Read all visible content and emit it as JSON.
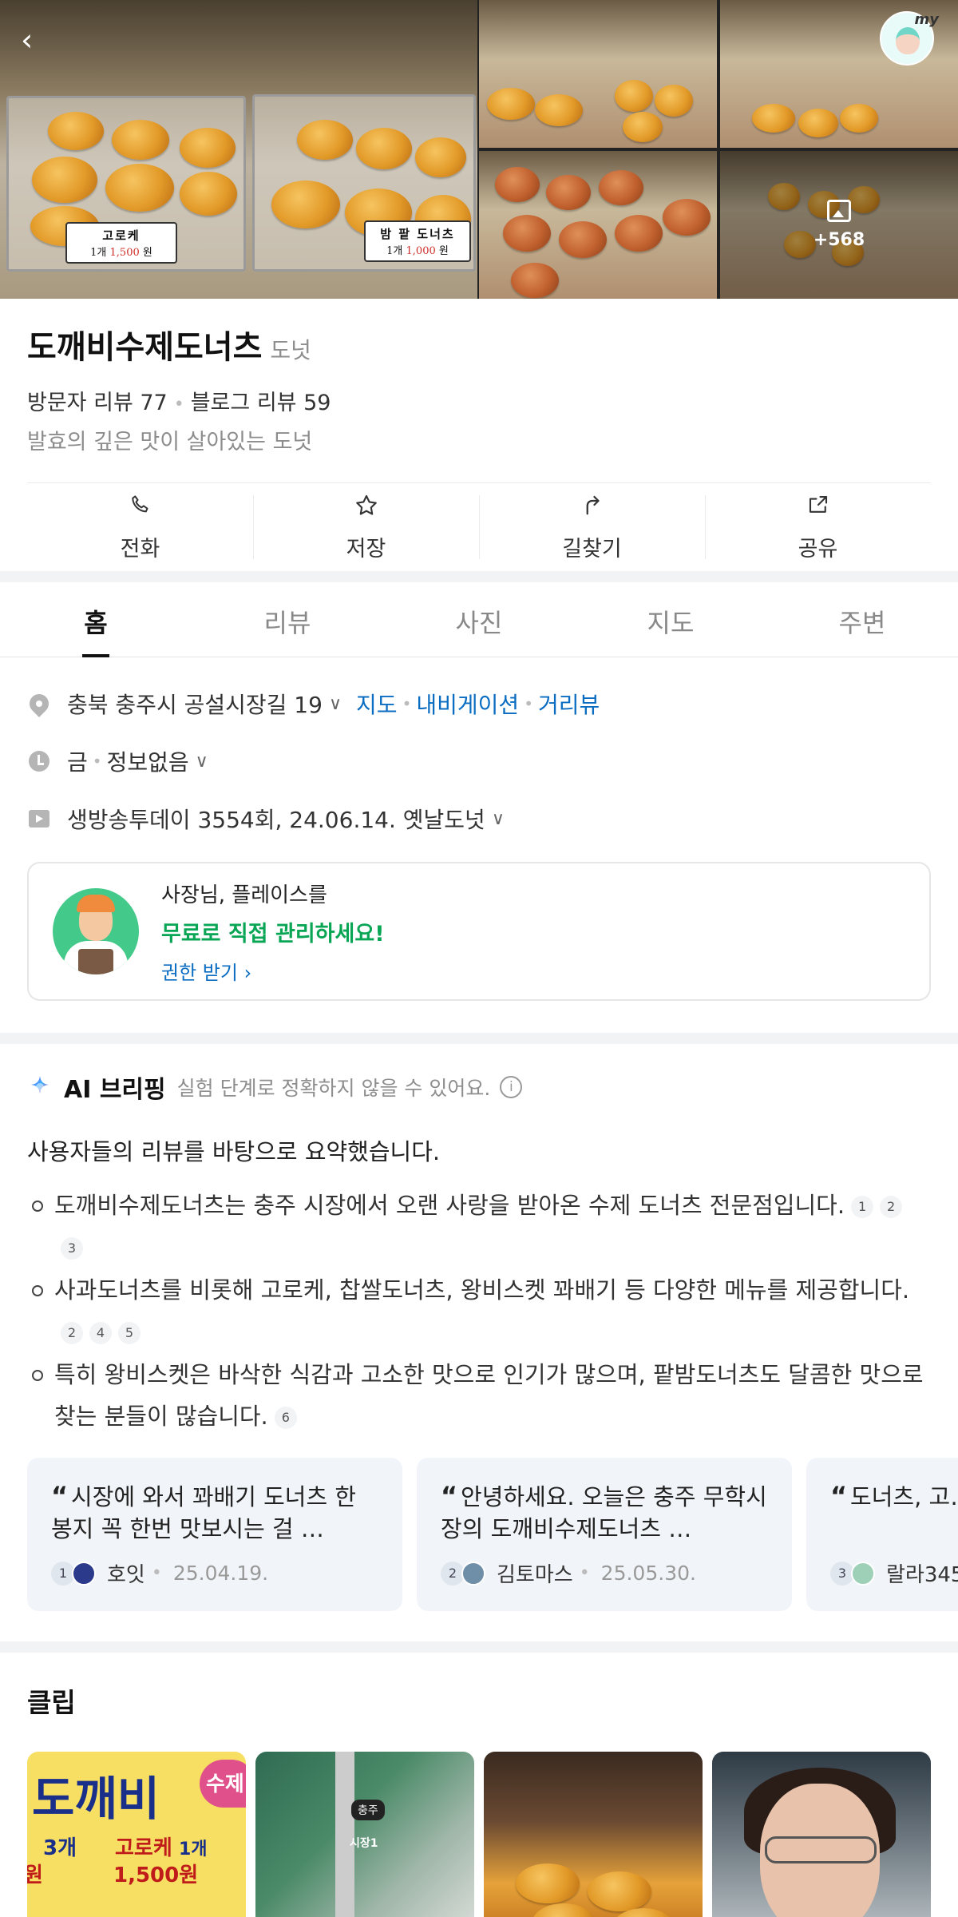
{
  "gallery": {
    "main_photo": {
      "label_left": {
        "name": "고로케",
        "qty": "1개",
        "price": "1,500",
        "unit": "원"
      },
      "label_right": {
        "name": "밤 팥 도너츠",
        "qty": "1개",
        "price": "1,000",
        "unit": "원"
      }
    },
    "more_count": "+568",
    "icons": {
      "back": "back-arrow-icon",
      "avatar": "my-avatar-icon",
      "photo": "photo-icon"
    },
    "avatar_label": "my"
  },
  "place": {
    "name": "도깨비수제도너츠",
    "category": "도넛",
    "visitor_reviews": "방문자 리뷰 77",
    "blog_reviews": "블로그 리뷰 59",
    "tagline": "발효의 깊은 맛이 살아있는 도넛"
  },
  "actions": [
    {
      "label": "전화",
      "icon": "phone-icon"
    },
    {
      "label": "저장",
      "icon": "star-icon"
    },
    {
      "label": "길찾기",
      "icon": "directions-icon"
    },
    {
      "label": "공유",
      "icon": "share-icon"
    }
  ],
  "tabs": [
    "홈",
    "리뷰",
    "사진",
    "지도",
    "주변"
  ],
  "info": {
    "address": "충북 충주시 공설시장길 19",
    "map_link": "지도",
    "nav_link": "내비게이션",
    "street_link": "거리뷰",
    "hours_day": "금",
    "hours_status": "정보없음",
    "tv": "생방송투데이 3554회, 24.06.14. 옛날도넛"
  },
  "owner_card": {
    "line1": "사장님, 플레이스를",
    "line2": "무료로 직접 관리하세요!",
    "line3": "권한 받기"
  },
  "ai": {
    "title": "AI 브리핑",
    "subtitle": "실험 단계로 정확하지 않을 수 있어요.",
    "intro": "사용자들의 리뷰를 바탕으로 요약했습니다.",
    "items": [
      {
        "text": "도깨비수제도너츠는 충주 시장에서 오랜 사랑을 받아온 수제 도너츠 전문점입니다.",
        "refs": [
          "1",
          "2",
          "3"
        ]
      },
      {
        "text": "사과도너츠를 비롯해 고로케, 찹쌀도너츠, 왕비스켓 꽈배기 등 다양한 메뉴를 제공합니다.",
        "refs": [
          "2",
          "4",
          "5"
        ]
      },
      {
        "text": "특히 왕비스켓은 바삭한 식감과 고소한 맛으로 인기가 많으며, 팥밤도너츠도 달콤한 맛으로 찾는 분들이 많습니다.",
        "refs": [
          "6"
        ]
      }
    ]
  },
  "review_cards": [
    {
      "quote": "시장에 와서 꽈배기 도너츠 한 봉지 꼭 한번 맛보시는 걸 …",
      "num": "1",
      "name": "호잇",
      "date": "25.04.19.",
      "avatar_color": "#2b3a8a"
    },
    {
      "quote": "안녕하세요. 오늘은 충주 무학시장의 도깨비수제도너츠 …",
      "num": "2",
      "name": "김토마스",
      "date": "25.05.30.",
      "avatar_color": "#6f8ea8"
    },
    {
      "quote": "도너츠, 고… 효도 잘되어…",
      "num": "3",
      "name": "랄라345",
      "date": "",
      "avatar_color": "#9ed0b8"
    }
  ],
  "clip": {
    "title": "클립",
    "items": [
      {
        "t1": "도깨비",
        "heart": "수제",
        "t2": "3개",
        "t3": "고로케",
        "t4": "1개",
        "t5": "1,500원",
        "t6": "원"
      },
      {
        "badge": "충주",
        "sub": "시장1"
      },
      {},
      {}
    ]
  }
}
